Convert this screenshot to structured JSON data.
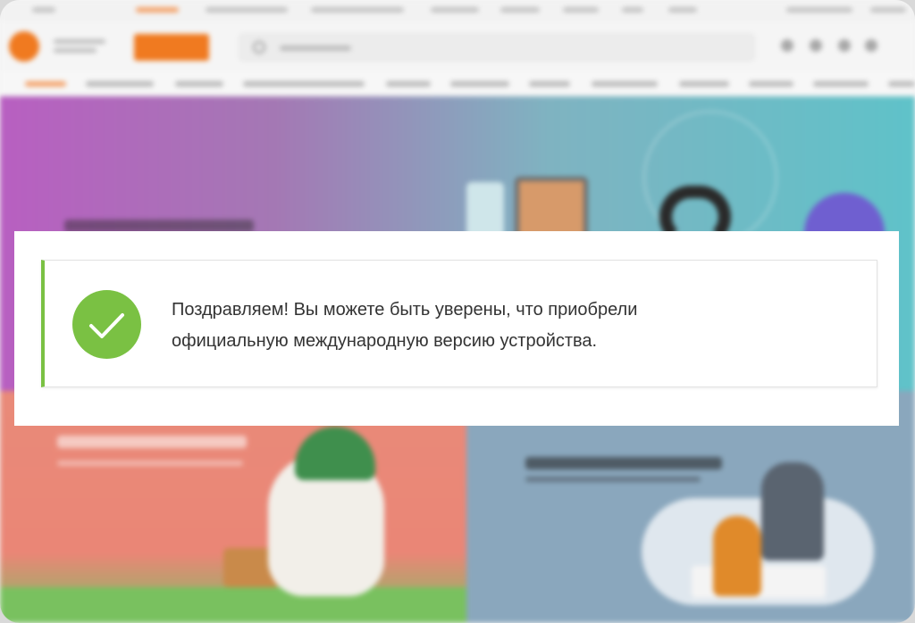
{
  "modal": {
    "message_line1": "Поздравляем! Вы можете быть уверены, что приобрели",
    "message_line2": "официальную международную версию устройства.",
    "icon": "check-circle-icon",
    "accent_color": "#7ac143"
  },
  "background": {
    "brand_color": "#f07a20",
    "blurred": true
  }
}
